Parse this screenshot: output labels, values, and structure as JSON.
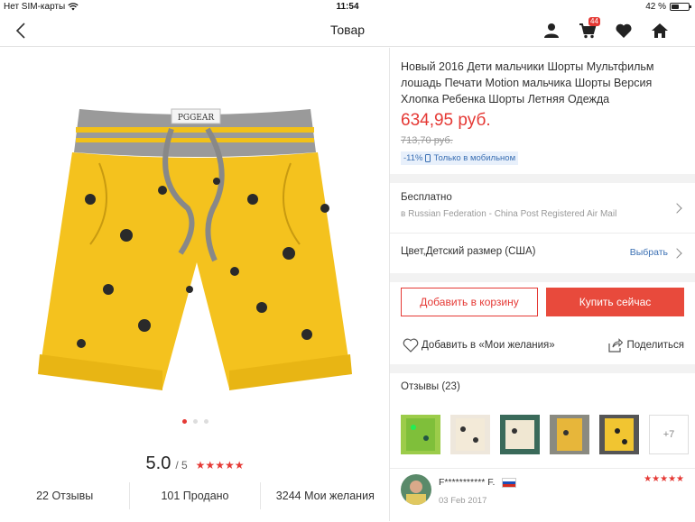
{
  "status_bar": {
    "carrier": "Нет SIM-карты",
    "time": "11:54",
    "battery": "42 %",
    "battery_level": 0.42
  },
  "nav": {
    "title": "Товар",
    "cart_count": "44"
  },
  "gallery": {
    "total_images": 3,
    "active_index": 0
  },
  "rating": {
    "value": "5.0",
    "max": "/ 5",
    "stars": "★★★★★"
  },
  "stats": [
    {
      "label": "22 Отзывы"
    },
    {
      "label": "101 Продано"
    },
    {
      "label": "3244 Мои желания"
    }
  ],
  "product": {
    "title": "Новый 2016 Дети мальчики Шорты Мультфильм лошадь Печати Motion мальчика Шорты Версия Хлопка Ребенка Шорты Летняя Одежда",
    "price": "634,95 руб.",
    "old_price": "713,70 руб.",
    "discount": "-11%",
    "mobile_only": "Только в мобильном"
  },
  "shipping": {
    "title": "Бесплатно",
    "details": "в Russian Federation - China Post Registered Air Mail"
  },
  "variant": {
    "label": "Цвет,Детский размер (США)",
    "select": "Выбрать"
  },
  "actions": {
    "add_to_cart": "Добавить в корзину",
    "buy_now": "Купить сейчас",
    "wishlist": "Добавить в «Мои желания»",
    "share": "Поделиться"
  },
  "reviews": {
    "header": "Отзывы (23)",
    "more": "+7",
    "first": {
      "name": "F*********** F.",
      "date": "03 Feb 2017",
      "stars": "★★★★★"
    }
  },
  "colors": {
    "accent": "#e53935",
    "link": "#3a6fb3"
  }
}
